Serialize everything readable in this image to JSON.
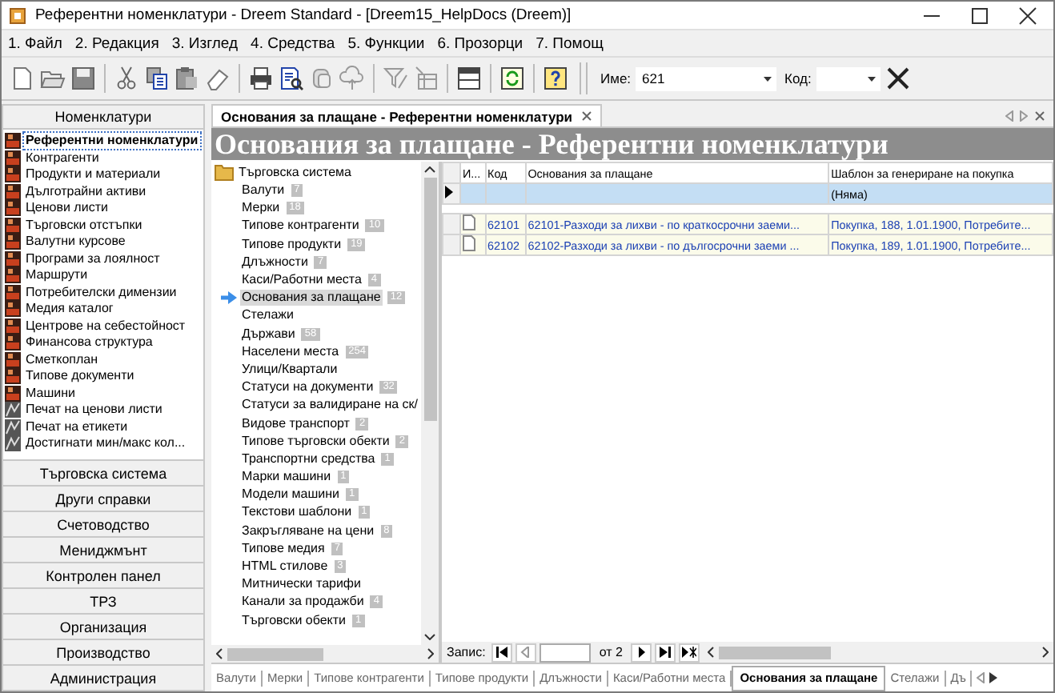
{
  "window": {
    "title": "Референтни номенклатури - Dreem Standard - [Dreem15_HelpDocs (Dreem)]"
  },
  "menu": [
    "1. Файл",
    "2. Редакция",
    "3. Изглед",
    "4. Средства",
    "5. Функции",
    "6. Прозорци",
    "7. Помощ"
  ],
  "toolbar": {
    "name_label": "Име:",
    "name_value": "621",
    "code_label": "Код:"
  },
  "sidebar": {
    "header": "Номенклатури",
    "items": [
      {
        "label": "Референтни номенклатури",
        "kind": "nomenclature",
        "selected": true
      },
      {
        "label": "Контрагенти",
        "kind": "nomenclature",
        "selected": false
      },
      {
        "label": "Продукти и материали",
        "kind": "nomenclature",
        "selected": false
      },
      {
        "label": "Дълготрайни активи",
        "kind": "nomenclature",
        "selected": false
      },
      {
        "label": "Ценови листи",
        "kind": "nomenclature",
        "selected": false
      },
      {
        "label": "Търговски отстъпки",
        "kind": "nomenclature",
        "selected": false
      },
      {
        "label": "Валутни курсове",
        "kind": "nomenclature",
        "selected": false
      },
      {
        "label": "Програми за лоялност",
        "kind": "nomenclature",
        "selected": false
      },
      {
        "label": "Маршрути",
        "kind": "nomenclature",
        "selected": false
      },
      {
        "label": "Потребителски димензии",
        "kind": "nomenclature",
        "selected": false
      },
      {
        "label": "Медия каталог",
        "kind": "nomenclature",
        "selected": false
      },
      {
        "label": "Центрове на себестойност",
        "kind": "nomenclature",
        "selected": false
      },
      {
        "label": "Финансова структура",
        "kind": "nomenclature",
        "selected": false
      },
      {
        "label": "Сметкоплан",
        "kind": "nomenclature",
        "selected": false
      },
      {
        "label": "Типове документи",
        "kind": "nomenclature",
        "selected": false
      },
      {
        "label": "Машини",
        "kind": "nomenclature",
        "selected": false
      },
      {
        "label": "Печат на ценови листи",
        "kind": "report",
        "selected": false
      },
      {
        "label": "Печат на етикети",
        "kind": "report",
        "selected": false
      },
      {
        "label": "Достигнати мин/макс кол...",
        "kind": "report",
        "selected": false
      }
    ],
    "sections": [
      "Търговска система",
      "Други справки",
      "Счетоводство",
      "Мениджмънт",
      "Контролен панел",
      "ТРЗ",
      "Организация",
      "Производство",
      "Администрация"
    ]
  },
  "document_tab": {
    "label": "Основания за плащане - Референтни номенклатури"
  },
  "banner": "Основания за плащане - Референтни номенклатури",
  "tree": {
    "root": "Търговска система",
    "items": [
      {
        "label": "Валути",
        "count": "7",
        "selected": false
      },
      {
        "label": "Мерки",
        "count": "18",
        "selected": false
      },
      {
        "label": "Типове контрагенти",
        "count": "10",
        "selected": false
      },
      {
        "label": "Типове продукти",
        "count": "19",
        "selected": false
      },
      {
        "label": "Длъжности",
        "count": "7",
        "selected": false
      },
      {
        "label": "Каси/Работни места",
        "count": "4",
        "selected": false
      },
      {
        "label": "Основания за плащане",
        "count": "12",
        "selected": true
      },
      {
        "label": "Стелажи",
        "selected": false
      },
      {
        "label": "Държави",
        "count": "58",
        "selected": false
      },
      {
        "label": "Населени места",
        "count": "254",
        "selected": false
      },
      {
        "label": "Улици/Квартали",
        "selected": false
      },
      {
        "label": "Статуси на документи",
        "count": "32",
        "selected": false
      },
      {
        "label": "Статуси за валидиране на ск/",
        "selected": false
      },
      {
        "label": "Видове транспорт",
        "count": "2",
        "selected": false
      },
      {
        "label": "Типове търговски обекти",
        "count": "2",
        "selected": false
      },
      {
        "label": "Транспортни средства",
        "count": "1",
        "selected": false
      },
      {
        "label": "Марки машини",
        "count": "1",
        "selected": false
      },
      {
        "label": "Модели машини",
        "count": "1",
        "selected": false
      },
      {
        "label": "Текстови шаблони",
        "count": "1",
        "selected": false
      },
      {
        "label": "Закръгляване на цени",
        "count": "8",
        "selected": false
      },
      {
        "label": "Типове медия",
        "count": "7",
        "selected": false
      },
      {
        "label": "HTML стилове",
        "count": "3",
        "selected": false
      },
      {
        "label": "Митнически тарифи",
        "selected": false
      },
      {
        "label": "Канали за продажби",
        "count": "4",
        "selected": false
      },
      {
        "label": "Търговски обекти",
        "count": "1",
        "selected": false
      }
    ]
  },
  "grid": {
    "columns": [
      "И...",
      "Код",
      "Основания за плащане",
      "Шаблон за генериране на покупка"
    ],
    "new_row": {
      "template": "(Няма)"
    },
    "rows": [
      {
        "code": "62101",
        "name": "62101-Разходи за лихви - по краткосрочни заеми...",
        "template": "Покупка, 188, 1.01.1900, Потребите..."
      },
      {
        "code": "62102",
        "name": "62102-Разходи за лихви - по дългосрочни заеми ...",
        "template": "Покупка, 189, 1.01.1900, Потребите..."
      }
    ]
  },
  "navigator": {
    "label": "Запис:",
    "of": "от 2"
  },
  "bottom_tabs": [
    {
      "label": "Валути",
      "selected": false
    },
    {
      "label": "Мерки",
      "selected": false
    },
    {
      "label": "Типове контрагенти",
      "selected": false
    },
    {
      "label": "Типове продукти",
      "selected": false
    },
    {
      "label": "Длъжности",
      "selected": false
    },
    {
      "label": "Каси/Работни места",
      "selected": false
    },
    {
      "label": "Основания за плащане",
      "selected": true
    },
    {
      "label": "Стелажи",
      "selected": false
    },
    {
      "label": "Дъ",
      "selected": false
    }
  ]
}
